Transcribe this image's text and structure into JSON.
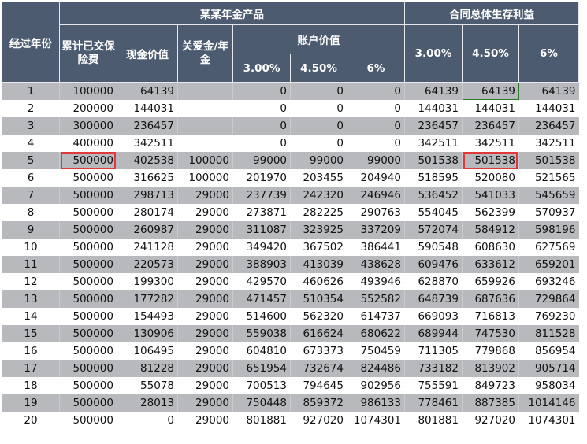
{
  "headers": {
    "year": "经过年份",
    "product": "某某年金产品",
    "benefit": "合同总体生存利益",
    "premium": "累计已交保险费",
    "cash_value": "现金价值",
    "care_annuity": "关爱金/年金",
    "account_value": "账户价值",
    "rates": [
      "3.00%",
      "4.50%",
      "6%"
    ],
    "benefit_rates": [
      "3.00%",
      "4.50%",
      "6%"
    ]
  },
  "rows": [
    [
      "1",
      "100000",
      "64139",
      "",
      "0",
      "0",
      "0",
      "64139",
      "64139",
      "64139"
    ],
    [
      "2",
      "200000",
      "144031",
      "",
      "0",
      "0",
      "0",
      "144031",
      "144031",
      "144031"
    ],
    [
      "3",
      "300000",
      "236457",
      "",
      "0",
      "0",
      "0",
      "236457",
      "236457",
      "236457"
    ],
    [
      "4",
      "400000",
      "342511",
      "",
      "0",
      "0",
      "0",
      "342511",
      "342511",
      "342511"
    ],
    [
      "5",
      "500000",
      "402538",
      "100000",
      "99000",
      "99000",
      "99000",
      "501538",
      "501538",
      "501538"
    ],
    [
      "6",
      "500000",
      "316625",
      "100000",
      "201970",
      "203455",
      "204940",
      "518595",
      "520080",
      "521565"
    ],
    [
      "7",
      "500000",
      "298713",
      "29000",
      "237739",
      "242320",
      "246946",
      "536452",
      "541033",
      "545659"
    ],
    [
      "8",
      "500000",
      "280174",
      "29000",
      "273871",
      "282225",
      "290763",
      "554045",
      "562399",
      "570937"
    ],
    [
      "9",
      "500000",
      "260987",
      "29000",
      "311087",
      "323925",
      "337209",
      "572074",
      "584912",
      "598196"
    ],
    [
      "10",
      "500000",
      "241128",
      "29000",
      "349420",
      "367502",
      "386441",
      "590548",
      "608630",
      "627569"
    ],
    [
      "11",
      "500000",
      "220573",
      "29000",
      "388903",
      "413039",
      "438628",
      "609476",
      "633612",
      "659201"
    ],
    [
      "12",
      "500000",
      "199300",
      "29000",
      "429570",
      "460626",
      "493946",
      "628870",
      "659926",
      "693246"
    ],
    [
      "13",
      "500000",
      "177282",
      "29000",
      "471457",
      "510354",
      "552582",
      "648739",
      "687636",
      "729864"
    ],
    [
      "14",
      "500000",
      "154493",
      "29000",
      "514600",
      "562320",
      "614737",
      "669093",
      "716813",
      "769230"
    ],
    [
      "15",
      "500000",
      "130906",
      "29000",
      "559038",
      "616624",
      "680622",
      "689944",
      "747530",
      "811528"
    ],
    [
      "16",
      "500000",
      "106495",
      "29000",
      "604810",
      "673373",
      "750459",
      "711305",
      "779868",
      "856954"
    ],
    [
      "17",
      "500000",
      "81228",
      "29000",
      "651954",
      "732674",
      "824486",
      "733182",
      "813902",
      "905714"
    ],
    [
      "18",
      "500000",
      "55078",
      "29000",
      "700513",
      "794645",
      "902956",
      "755591",
      "849723",
      "958034"
    ],
    [
      "19",
      "500000",
      "28013",
      "29000",
      "750448",
      "859372",
      "986133",
      "778461",
      "887385",
      "1014146"
    ],
    [
      "20",
      "500000",
      "0",
      "29000",
      "801881",
      "927020",
      "1074301",
      "801881",
      "927020",
      "1074301"
    ]
  ],
  "highlights": [
    {
      "row": 5,
      "column": "累计已交保险费"
    },
    {
      "row": 5,
      "column": "合同总体生存利益 4.50%"
    }
  ],
  "selected_cell": {
    "row": 1,
    "column": "合同总体生存利益 4.50%"
  },
  "colors": {
    "header": "#4c5b70",
    "row_shade": "#b7b9bd",
    "highlight": "#e2383c"
  }
}
